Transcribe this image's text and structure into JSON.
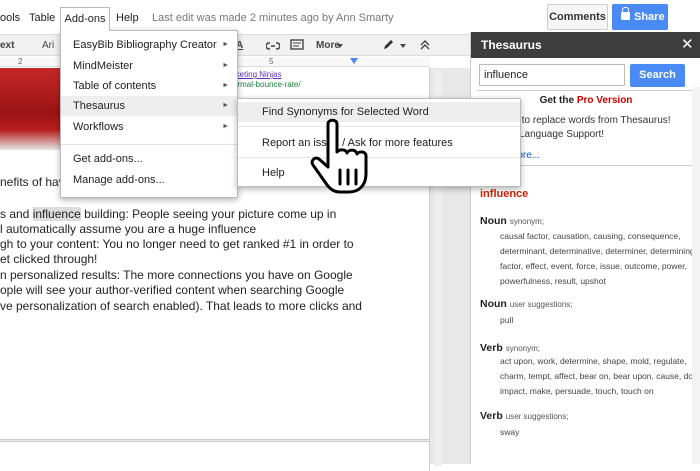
{
  "menubar": {
    "tools": "ools",
    "table": "Table",
    "addons": "Add-ons",
    "help": "Help",
    "last_edit": "Last edit was made 2 minutes ago by Ann Smarty",
    "comments": "Comments",
    "share": "Share"
  },
  "toolbar": {
    "text_style": "ext",
    "font": "Ari",
    "text_color_label": "A",
    "more": "More"
  },
  "ruler": {
    "two": "2",
    "five": "5"
  },
  "addons_menu": {
    "items": [
      {
        "label": "EasyBib Bibliography Creator",
        "arrow": "►"
      },
      {
        "label": "MindMeister",
        "arrow": "►"
      },
      {
        "label": "Table of contents",
        "arrow": "►"
      },
      {
        "label": "Thesaurus",
        "arrow": "►"
      },
      {
        "label": "Workflows",
        "arrow": "►"
      },
      {
        "label": "Get add-ons..."
      },
      {
        "label": "Manage add-ons..."
      }
    ]
  },
  "thesaurus_submenu": {
    "items": [
      {
        "label": "Find Synonyms for Selected Word"
      },
      {
        "label": "Report an issue / Ask for more features"
      },
      {
        "label": "Help"
      }
    ]
  },
  "document": {
    "link1": "rketing Ninjas",
    "link2": "ormal-bounce-rate/",
    "line1": "nefits of hav",
    "line2a": "s and ",
    "line2b": "influence",
    "line2c": " building: People seeing your picture come up in",
    "line3": "l automatically assume you are a huge influence",
    "line4": "gh to your content: You no longer need to get ranked #1 in order to",
    "line5": "et clicked through!",
    "line6": "n personalized results: The more connections you have on Google",
    "line7": "ople will see your author-verified content when searching Google",
    "line8": "ve personalization of search enabled). That leads to more clicks and"
  },
  "thesaurus": {
    "title": "Thesaurus",
    "close": "✕",
    "query": "influence",
    "search_button": "Search",
    "pro_prefix": "Get the ",
    "pro_link": "Pro Version",
    "pro_line1": "ck to replace words from Thesaurus!",
    "pro_line2": "lti Language Support!",
    "pro_more": "more...",
    "word": "influence",
    "senses": [
      {
        "pos": "Noun",
        "sub": "synonym;",
        "text": "causal factor, causation, causing, consequence, determinant, determinative, determiner, determining factor, effect, event, force, issue, outcome, power, powerfulness, result, upshot"
      },
      {
        "pos": "Noun",
        "sub": "user suggestions;",
        "text": "pull"
      },
      {
        "pos": "Verb",
        "sub": "synonym;",
        "text": "act upon, work, determine, shape, mold, regulate, charm, tempt, affect, bear on, bear upon, cause, do, impact, make, persuade, touch, touch on"
      },
      {
        "pos": "Verb",
        "sub": "user suggestions;",
        "text": "sway"
      }
    ]
  }
}
